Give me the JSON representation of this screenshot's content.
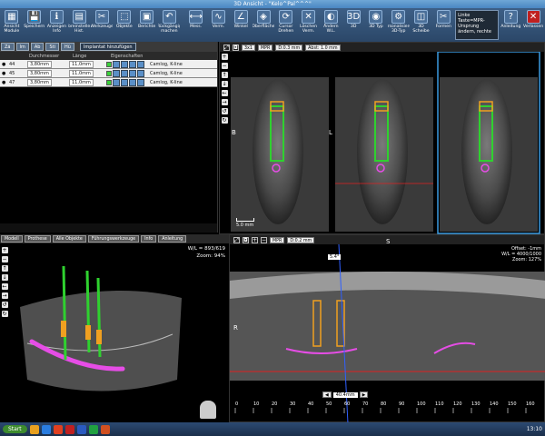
{
  "window": {
    "title": "3D Ansicht  - \"Kelo^Pal^^^\""
  },
  "toolbar": {
    "buttons": [
      {
        "label": "Ansicht Module",
        "icon": "grid-icon"
      },
      {
        "label": "Speichern",
        "icon": "save-icon"
      },
      {
        "label": "Anzeigen Info",
        "icon": "info-icon"
      },
      {
        "label": "Voreinstellen Hist.",
        "icon": "histogram-icon"
      },
      {
        "label": "Werkzeuge",
        "icon": "tools-icon"
      },
      {
        "label": "Objekte",
        "icon": "objects-icon"
      },
      {
        "label": "Berichte",
        "icon": "report-icon"
      },
      {
        "label": "Rückgängig machen",
        "icon": "undo-icon"
      },
      {
        "label": "Mess.",
        "icon": "measure-icon"
      },
      {
        "label": "Verm.",
        "icon": "nerve-icon"
      },
      {
        "label": "Winkel",
        "icon": "angle-icon"
      },
      {
        "label": "Oberfläche",
        "icon": "surface-icon"
      },
      {
        "label": "Cursor Drehen",
        "icon": "rotate-icon"
      },
      {
        "label": "Löschen Verm.",
        "icon": "delete-icon"
      },
      {
        "label": "Ändern W.L.",
        "icon": "contrast-icon"
      },
      {
        "label": "3D",
        "icon": "3d-icon"
      },
      {
        "label": "3D Typ",
        "icon": "3d-type-icon"
      },
      {
        "label": "Personalisieren 3D-Typ",
        "icon": "personalize-icon"
      },
      {
        "label": "3D Scheibe",
        "icon": "slice-icon"
      },
      {
        "label": "Formen",
        "icon": "scissors-icon"
      }
    ],
    "info_box": "Linke Taste=MPR-Ursprung ändern, rechte",
    "help_label": "Anleitung",
    "exit_label": "Verlassen"
  },
  "implant_panel": {
    "tabs": [
      "Zä",
      "Im",
      "Ab",
      "Sti",
      "Hü"
    ],
    "add_label": "Implantat hinzufügen",
    "headers": {
      "diameter": "Durchmesser",
      "length": "Länge",
      "properties": "Eigenschaften"
    },
    "rows": [
      {
        "id": "44",
        "diameter": "3,80mm",
        "length": "11,0mm",
        "brand": "Camlog, K-line"
      },
      {
        "id": "45",
        "diameter": "3,80mm",
        "length": "11,0mm",
        "brand": "Camlog, K-line"
      },
      {
        "id": "47",
        "diameter": "3,80mm",
        "length": "11,0mm",
        "brand": "Camlog, K-line"
      }
    ]
  },
  "sagittal_views": {
    "toolbar": [
      "3x1",
      "MPR",
      "D:0.3 mm",
      "Abst: 1.0 mm"
    ],
    "left_label": "B",
    "right_label": "L",
    "scale": "5.0 mm"
  },
  "model_view": {
    "tabs": [
      "Modell",
      "Prothese",
      "Alle Objekte",
      "Führungswerkzeuge",
      "Info",
      "Anleitung"
    ],
    "wl": "W/L = 893/619",
    "zoom": "Zoom: 94%"
  },
  "panoramic_view": {
    "toolbar": [
      "MPR",
      "D:0.2 mm"
    ],
    "top_label": "S",
    "left_label": "R",
    "angle": "5.4°",
    "offset": "Offset: -1mm",
    "wl": "W/L = 4000/1000",
    "zoom": "Zoom: 127%",
    "pos_label": "40.4mm",
    "ruler": [
      "0",
      "10",
      "20",
      "30",
      "40",
      "50",
      "60",
      "70",
      "80",
      "90",
      "100",
      "110",
      "120",
      "130",
      "140",
      "150",
      "160"
    ]
  },
  "taskbar": {
    "start": "Start",
    "clock": "13:10"
  },
  "colors": {
    "implant": "#2fd12f",
    "nerve": "#e64de6",
    "accent": "#3b7fc4"
  }
}
